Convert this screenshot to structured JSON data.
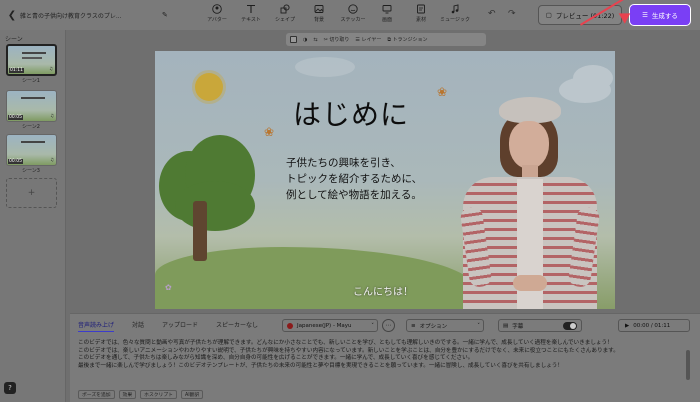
{
  "window": {
    "title": "雑と青の子供向け教育クラスのプレ...",
    "back_icon": "chevron-left-icon",
    "edit_icon": "pencil-icon"
  },
  "toolbar": {
    "tools": [
      {
        "label": "アバター",
        "icon": "avatar-icon"
      },
      {
        "label": "テキスト",
        "icon": "text-icon"
      },
      {
        "label": "シェイプ",
        "icon": "shape-icon"
      },
      {
        "label": "背景",
        "icon": "background-icon"
      },
      {
        "label": "ステッカー",
        "icon": "sticker-icon"
      },
      {
        "label": "画面",
        "icon": "screen-icon"
      },
      {
        "label": "素材",
        "icon": "media-icon"
      },
      {
        "label": "ミュージック",
        "icon": "music-icon"
      }
    ],
    "undo_icon": "undo-icon",
    "redo_icon": "redo-icon",
    "preview_label": "プレビュー (01:22)",
    "generate_label": "生成する"
  },
  "scenes": {
    "header": "シーン",
    "items": [
      {
        "label": "シーン1",
        "time": "01:11",
        "active": true
      },
      {
        "label": "シーン2",
        "time": "00:05",
        "active": false
      },
      {
        "label": "シーン3",
        "time": "00:05",
        "active": false
      }
    ],
    "add_label": "+"
  },
  "canvas_tools": {
    "trim_label": "切り取り",
    "layer_label": "レイヤー",
    "transition_label": "トランジション"
  },
  "slide": {
    "heading": "はじめに",
    "body_lines": [
      "子供たちの興味を引き、",
      "トピックを紹介するために、",
      "例として絵や物語を加える。"
    ],
    "caption": "こんにちは！"
  },
  "script_panel": {
    "tabs": [
      "音声読み上げ",
      "対話",
      "アップロード",
      "スピーカーなし"
    ],
    "active_tab": 0,
    "voice": "Japanese(JP) - Mayu",
    "option_label": "オプション",
    "subtitle_label": "字幕",
    "subtitle_on": true,
    "playback": "00:00 / 01:11",
    "script_lines": [
      "このビデオでは、色々な質問と動画や写真が子供たちが理解できます。どんなにか小さなことでも、新しいことを学び、ともしても理解しいきのでする。一緒に学んで、成長していく過程を楽しんでいきましょう！",
      "このビデオでは、楽しいアニメーションやわかりやすい説明で、子供たちが興味を持ちやすい内容になっています。新しいことを学ぶことは、自分を豊かにするだけでなく、未来に役立つことにもたくさんあります。",
      "このビデオを通して、子供たちは楽しみながら知識を深め、自分自身の可能性を広げることができます。一緒に学んで、成長していく喜びを感じてください。",
      "最後まで一緒に楽しんで学びましょう！このビデオテンプレートが、子供たちの未来の可能性と夢や目標を実現できることを願っています。一緒に冒険し、成長していく喜びを共有しましょう！"
    ],
    "actions": [
      "ポーズを追加",
      "効果",
      "ホスクリプト",
      "AI翻訳"
    ]
  },
  "colors": {
    "accent": "#7a3ff5",
    "annotation_arrow": "#e8424f",
    "overlay": "#6f6f6f"
  }
}
